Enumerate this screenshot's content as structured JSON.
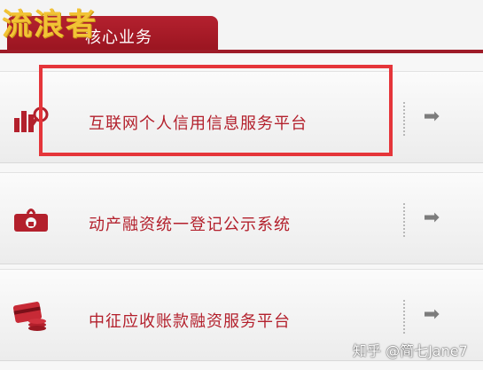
{
  "logo_text": "流浪者",
  "tab": {
    "label": "核心业务"
  },
  "rows": [
    {
      "label": "互联网个人信用信息服务平台",
      "icon": "bar-chart-magnifier-icon",
      "action_icon": "arrow-right-icon",
      "action_glyph": "➡"
    },
    {
      "label": "动产融资统一登记公示系统",
      "icon": "banknote-lock-icon",
      "action_icon": "arrow-right-icon",
      "action_glyph": "➡"
    },
    {
      "label": "中征应收账款融资服务平台",
      "icon": "card-coins-icon",
      "action_icon": "arrow-right-icon",
      "action_glyph": "➡"
    }
  ],
  "credit": "知乎 @简七Jane7",
  "colors": {
    "brand_red": "#b3202c",
    "highlight": "#e5353a",
    "logo": "#f2c335"
  }
}
